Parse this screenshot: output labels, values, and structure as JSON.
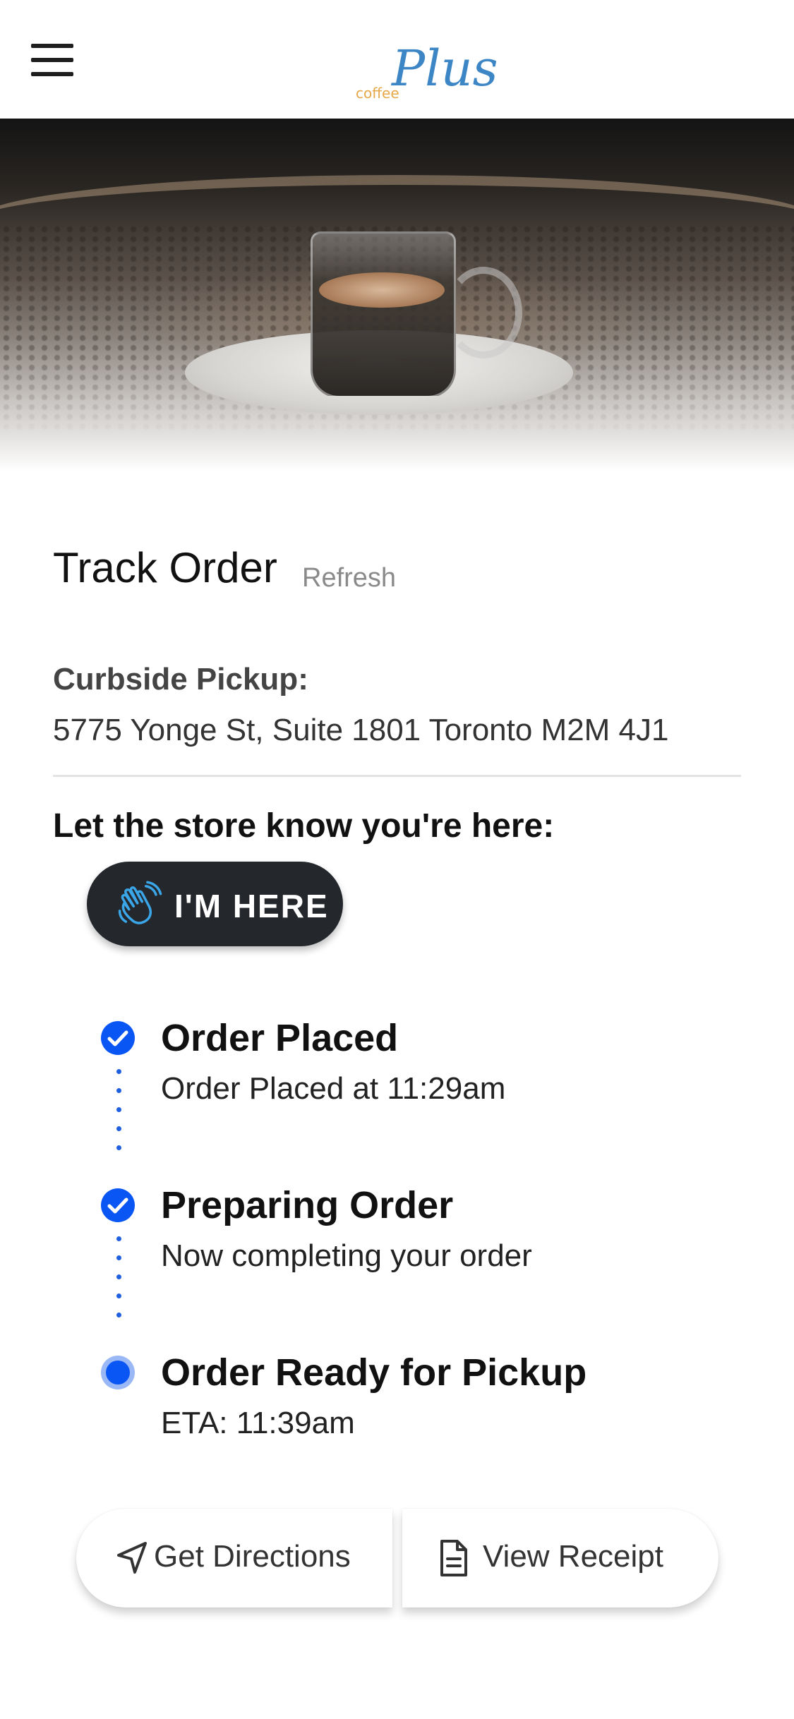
{
  "header": {
    "logo_small": "coffee",
    "logo_big": "Plus"
  },
  "track": {
    "title": "Track Order",
    "refresh": "Refresh"
  },
  "pickup": {
    "label": "Curbside Pickup:",
    "address": "5775 Yonge St, Suite 1801 Toronto M2M 4J1"
  },
  "arrival": {
    "prompt": "Let the store know you're here:",
    "button_label": "I'M HERE"
  },
  "steps": [
    {
      "title": "Order Placed",
      "desc": "Order Placed at 11:29am",
      "status": "done"
    },
    {
      "title": "Preparing Order",
      "desc": "Now completing your order",
      "status": "done"
    },
    {
      "title": "Order Ready for Pickup",
      "desc": "ETA: 11:39am",
      "status": "current"
    }
  ],
  "actions": {
    "directions": "Get Directions",
    "receipt": "View Receipt"
  },
  "colors": {
    "accent": "#0a56f5",
    "dark_button": "#24272c",
    "wave_icon": "#3aa6e8"
  },
  "icons": {
    "menu": "hamburger-icon",
    "wave": "waving-hand-icon",
    "done": "check-circle-icon",
    "current": "radio-dot-icon",
    "directions": "navigation-arrow-icon",
    "receipt": "document-icon"
  }
}
